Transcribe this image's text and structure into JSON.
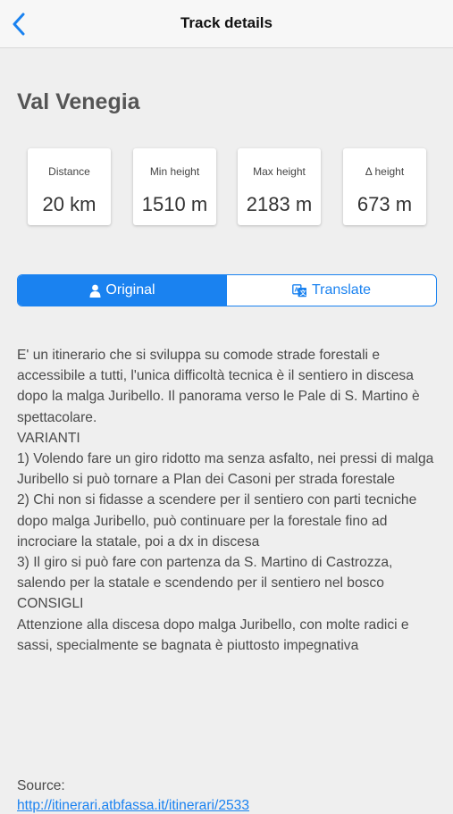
{
  "nav": {
    "title": "Track details",
    "back_icon": "chevron-left-icon"
  },
  "track": {
    "name": "Val Venegia"
  },
  "stats": [
    {
      "label": "Distance",
      "value": "20 km"
    },
    {
      "label": "Min height",
      "value": "1510 m"
    },
    {
      "label": "Max height",
      "value": "2183 m"
    },
    {
      "label": "Δ height",
      "value": "673 m"
    }
  ],
  "tabs": {
    "original": {
      "label": "Original",
      "icon": "person-icon",
      "selected": true
    },
    "translate": {
      "label": "Translate",
      "icon": "translate-icon",
      "selected": false
    }
  },
  "description": "E' un itinerario che si sviluppa su comode strade forestali e accessibile a tutti, l'unica difficoltà tecnica è il sentiero in discesa dopo la malga Juribello. Il panorama verso le Pale di S. Martino è spettacolare.\nVARIANTI\n1) Volendo fare un giro ridotto ma senza asfalto, nei pressi di malga Juribello si può tornare a Plan dei Casoni per strada forestale\n2) Chi non si fidasse a scendere per il sentiero con parti tecniche dopo malga Juribello, può continuare per la forestale fino ad incrociare la statale, poi a dx in discesa\n3) Il giro si può fare con partenza da S. Martino di Castrozza, salendo per la statale e scendendo per il sentiero nel bosco\nCONSIGLI\nAttenzione alla discesa dopo malga Juribello, con molte radici e sassi, specialmente se bagnata è piuttosto impegnativa",
  "source": {
    "label": "Source:",
    "link": "http://itinerari.atbfassa.it/itinerari/2533"
  },
  "colors": {
    "accent": "#1a82f0",
    "background": "#efefef",
    "card": "#ffffff"
  }
}
